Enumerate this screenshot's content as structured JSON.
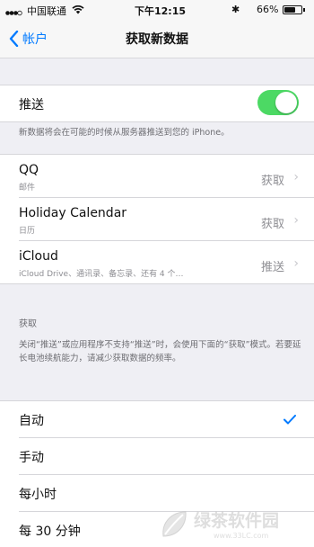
{
  "status_bar": {
    "carrier": "中国联通",
    "time": "下午12:15",
    "battery_percent": "66%",
    "battery_level": 0.66
  },
  "nav": {
    "back_label": "帐户",
    "title": "获取新数据"
  },
  "push": {
    "label": "推送",
    "enabled": true,
    "footer": "新数据将会在可能的时候从服务器推送到您的 iPhone。"
  },
  "accounts": [
    {
      "name": "QQ",
      "subtitle": "邮件",
      "value": "获取"
    },
    {
      "name": "Holiday Calendar",
      "subtitle": "日历",
      "value": "获取"
    },
    {
      "name": "iCloud",
      "subtitle": "iCloud Drive、通讯录、备忘录、还有 4 个…",
      "value": "推送"
    }
  ],
  "fetch": {
    "header": "获取",
    "footer": "关闭“推送”或应用程序不支持“推送”时，会使用下面的“获取”模式。若要延长电池续航能力，请减少获取数据的频率。",
    "options": [
      "自动",
      "手动",
      "每小时",
      "每 30 分钟"
    ],
    "selected_index": 0
  },
  "watermark": {
    "name": "绿茶软件园",
    "domain": "www.33LC.com"
  },
  "colors": {
    "toggle_on": "#4cd964",
    "ios_blue": "#007aff"
  }
}
